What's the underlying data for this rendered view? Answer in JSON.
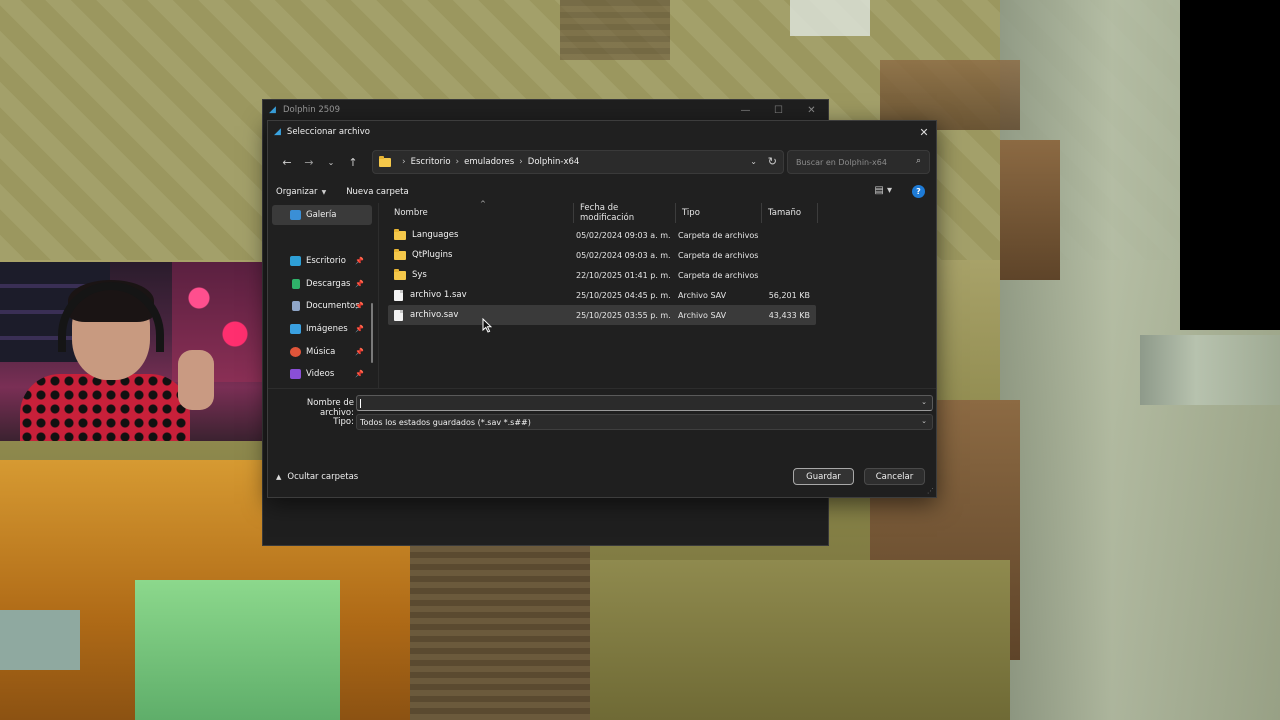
{
  "dolphin_window": {
    "title": "Dolphin 2509"
  },
  "dialog": {
    "title": "Seleccionar archivo",
    "breadcrumb": [
      "Escritorio",
      "emuladores",
      "Dolphin-x64"
    ],
    "search_placeholder": "Buscar en Dolphin-x64",
    "toolbar": {
      "organize": "Organizar",
      "new_folder": "Nueva carpeta"
    },
    "nav_pane": [
      {
        "label": "Galería",
        "icon": "gallery-icon",
        "color": "#3a8fd6",
        "pinned": false
      },
      {
        "label": "Escritorio",
        "icon": "desktop-icon",
        "color": "#2e9fd6",
        "pinned": true
      },
      {
        "label": "Descargas",
        "icon": "downloads-icon",
        "color": "#2fb36a",
        "pinned": true
      },
      {
        "label": "Documentos",
        "icon": "documents-icon",
        "color": "#8fa6c8",
        "pinned": true
      },
      {
        "label": "Imágenes",
        "icon": "images-icon",
        "color": "#3aa0e0",
        "pinned": true
      },
      {
        "label": "Música",
        "icon": "music-icon",
        "color": "#e0553a",
        "pinned": true
      },
      {
        "label": "Videos",
        "icon": "videos-icon",
        "color": "#8a4fd6",
        "pinned": true
      }
    ],
    "columns": {
      "name": "Nombre",
      "modified": "Fecha de modificación",
      "type": "Tipo",
      "size": "Tamaño"
    },
    "files": [
      {
        "name": "Languages",
        "modified": "05/02/2024 09:03 a. m.",
        "type": "Carpeta de archivos",
        "size": "",
        "kind": "folder"
      },
      {
        "name": "QtPlugins",
        "modified": "05/02/2024 09:03 a. m.",
        "type": "Carpeta de archivos",
        "size": "",
        "kind": "folder"
      },
      {
        "name": "Sys",
        "modified": "22/10/2025 01:41 p. m.",
        "type": "Carpeta de archivos",
        "size": "",
        "kind": "folder"
      },
      {
        "name": "archivo 1.sav",
        "modified": "25/10/2025 04:45 p. m.",
        "type": "Archivo SAV",
        "size": "56,201 KB",
        "kind": "file"
      },
      {
        "name": "archivo.sav",
        "modified": "25/10/2025 03:55 p. m.",
        "type": "Archivo SAV",
        "size": "43,433 KB",
        "kind": "file",
        "selected": true
      }
    ],
    "filename_label": "Nombre de archivo:",
    "filename_value": "",
    "type_label": "Tipo:",
    "type_value": "Todos los estados guardados (*.sav *.s##)",
    "hide_folders": "Ocultar carpetas",
    "save_button": "Guardar",
    "cancel_button": "Cancelar"
  }
}
